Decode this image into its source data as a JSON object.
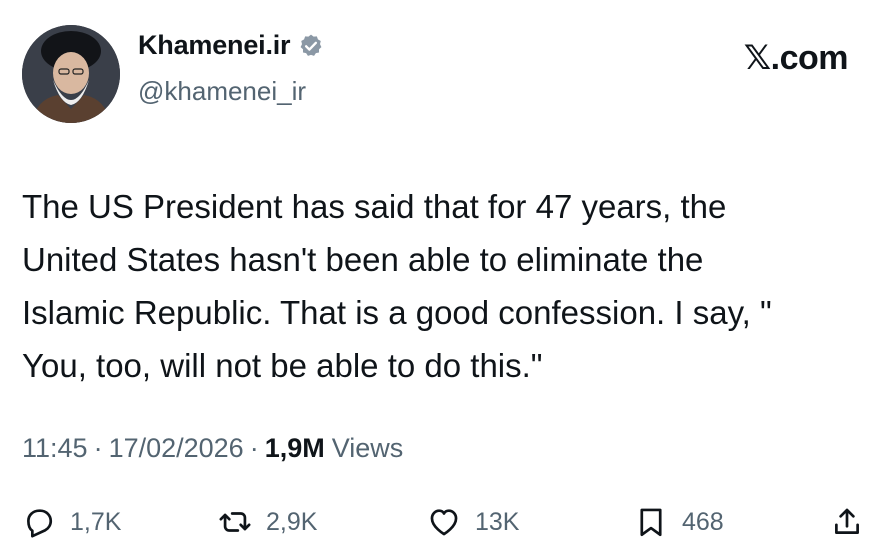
{
  "author": {
    "display_name": "Khamenei.ir",
    "handle": "@khamenei_ir",
    "verified_icon": "verified-badge-icon",
    "verified_color": "#8b98a5"
  },
  "brand": {
    "label": "𝕏.com"
  },
  "tweet": {
    "lines": [
      "The US President has said that for 47 years, the",
      "United States hasn't been able to eliminate the",
      "Islamic Republic. That is a good confession. I say, \"",
      "You, too, will not be able to do this.\""
    ]
  },
  "meta": {
    "time": "11:45",
    "date": "17/02/2026",
    "separator": "·",
    "views_count": "1,9M",
    "views_label": "Views"
  },
  "actions": {
    "reply": {
      "icon": "reply-icon",
      "count": "1,7K"
    },
    "retweet": {
      "icon": "retweet-icon",
      "count": "2,9K"
    },
    "like": {
      "icon": "heart-icon",
      "count": "13K"
    },
    "bookmark": {
      "icon": "bookmark-icon",
      "count": "468"
    },
    "share": {
      "icon": "share-icon"
    }
  },
  "colors": {
    "text_primary": "#0f1419",
    "text_secondary": "#536471"
  }
}
